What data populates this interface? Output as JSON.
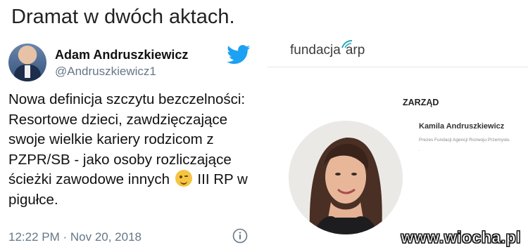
{
  "headline": "Dramat w dwóch aktach.",
  "tweet": {
    "author_name": "Adam Andruszkiewicz",
    "author_handle": "@Andruszkiewicz1",
    "text_part1": "Nowa definicja szczytu bezczelności: Resortowe dzieci, zawdzięczające swoje wielkie kariery rodzicom z PZPR/SB - jako osoby rozliczające ścieżki zawodowe innych",
    "text_part2": " III RP w pigułce.",
    "emoji_icon": "winking-face-emoji",
    "timestamp": "12:22 PM · Nov 20, 2018",
    "icons": [
      "twitter-bird-icon",
      "info-icon"
    ],
    "brand_color": "#1da1f2"
  },
  "foundation": {
    "logo_text_main": "fundacja",
    "logo_text_arp": "arp",
    "section_title": "ZARZĄD",
    "member_name": "Kamila Andruszkiewicz",
    "member_role": "Prezes Fundacji Agencji Rozwoju Przemysłu.",
    "member_extra": "."
  },
  "watermark": "www.wiocha.pl"
}
